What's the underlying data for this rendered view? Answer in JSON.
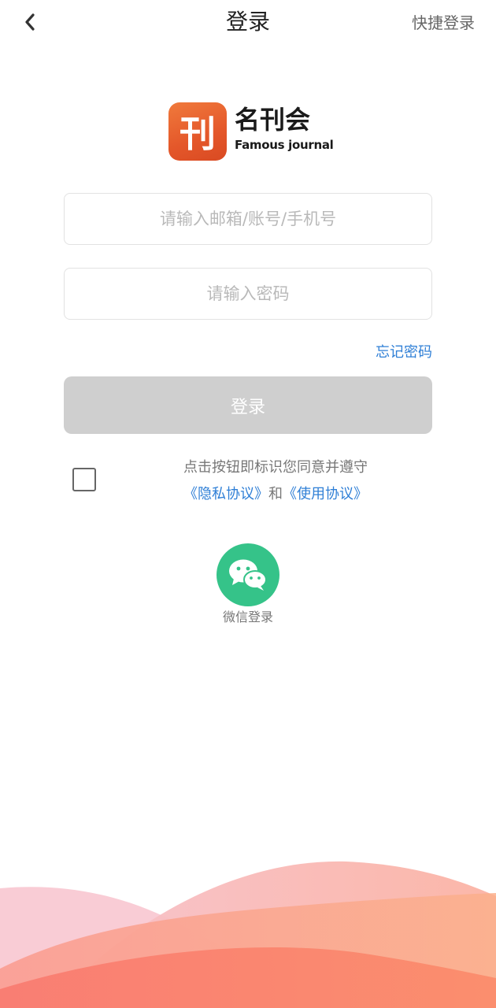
{
  "header": {
    "back_icon": "chevron-left-icon",
    "title": "登录",
    "quick_login": "快捷登录"
  },
  "logo": {
    "mark_char": "刊",
    "name": "名刊会",
    "subtitle": "Famous journal"
  },
  "form": {
    "account_placeholder": "请输入邮箱/账号/手机号",
    "account_value": "",
    "password_placeholder": "请输入密码",
    "password_value": "",
    "forgot_password": "忘记密码",
    "login_button": "登录",
    "login_button_color": "#cfcfcf"
  },
  "agreement": {
    "checked": false,
    "line1": "点击按钮即标识您同意并遵守",
    "privacy_link": "《隐私协议》",
    "and": "和",
    "terms_link": "《使用协议》"
  },
  "wechat": {
    "icon": "wechat-icon",
    "label": "微信登录",
    "color": "#35c389"
  },
  "colors": {
    "link": "#2f7fd6",
    "logo_orange": "#e4572a",
    "wave_pink": "#f7b6c0",
    "wave_coral": "#f97c6a"
  }
}
